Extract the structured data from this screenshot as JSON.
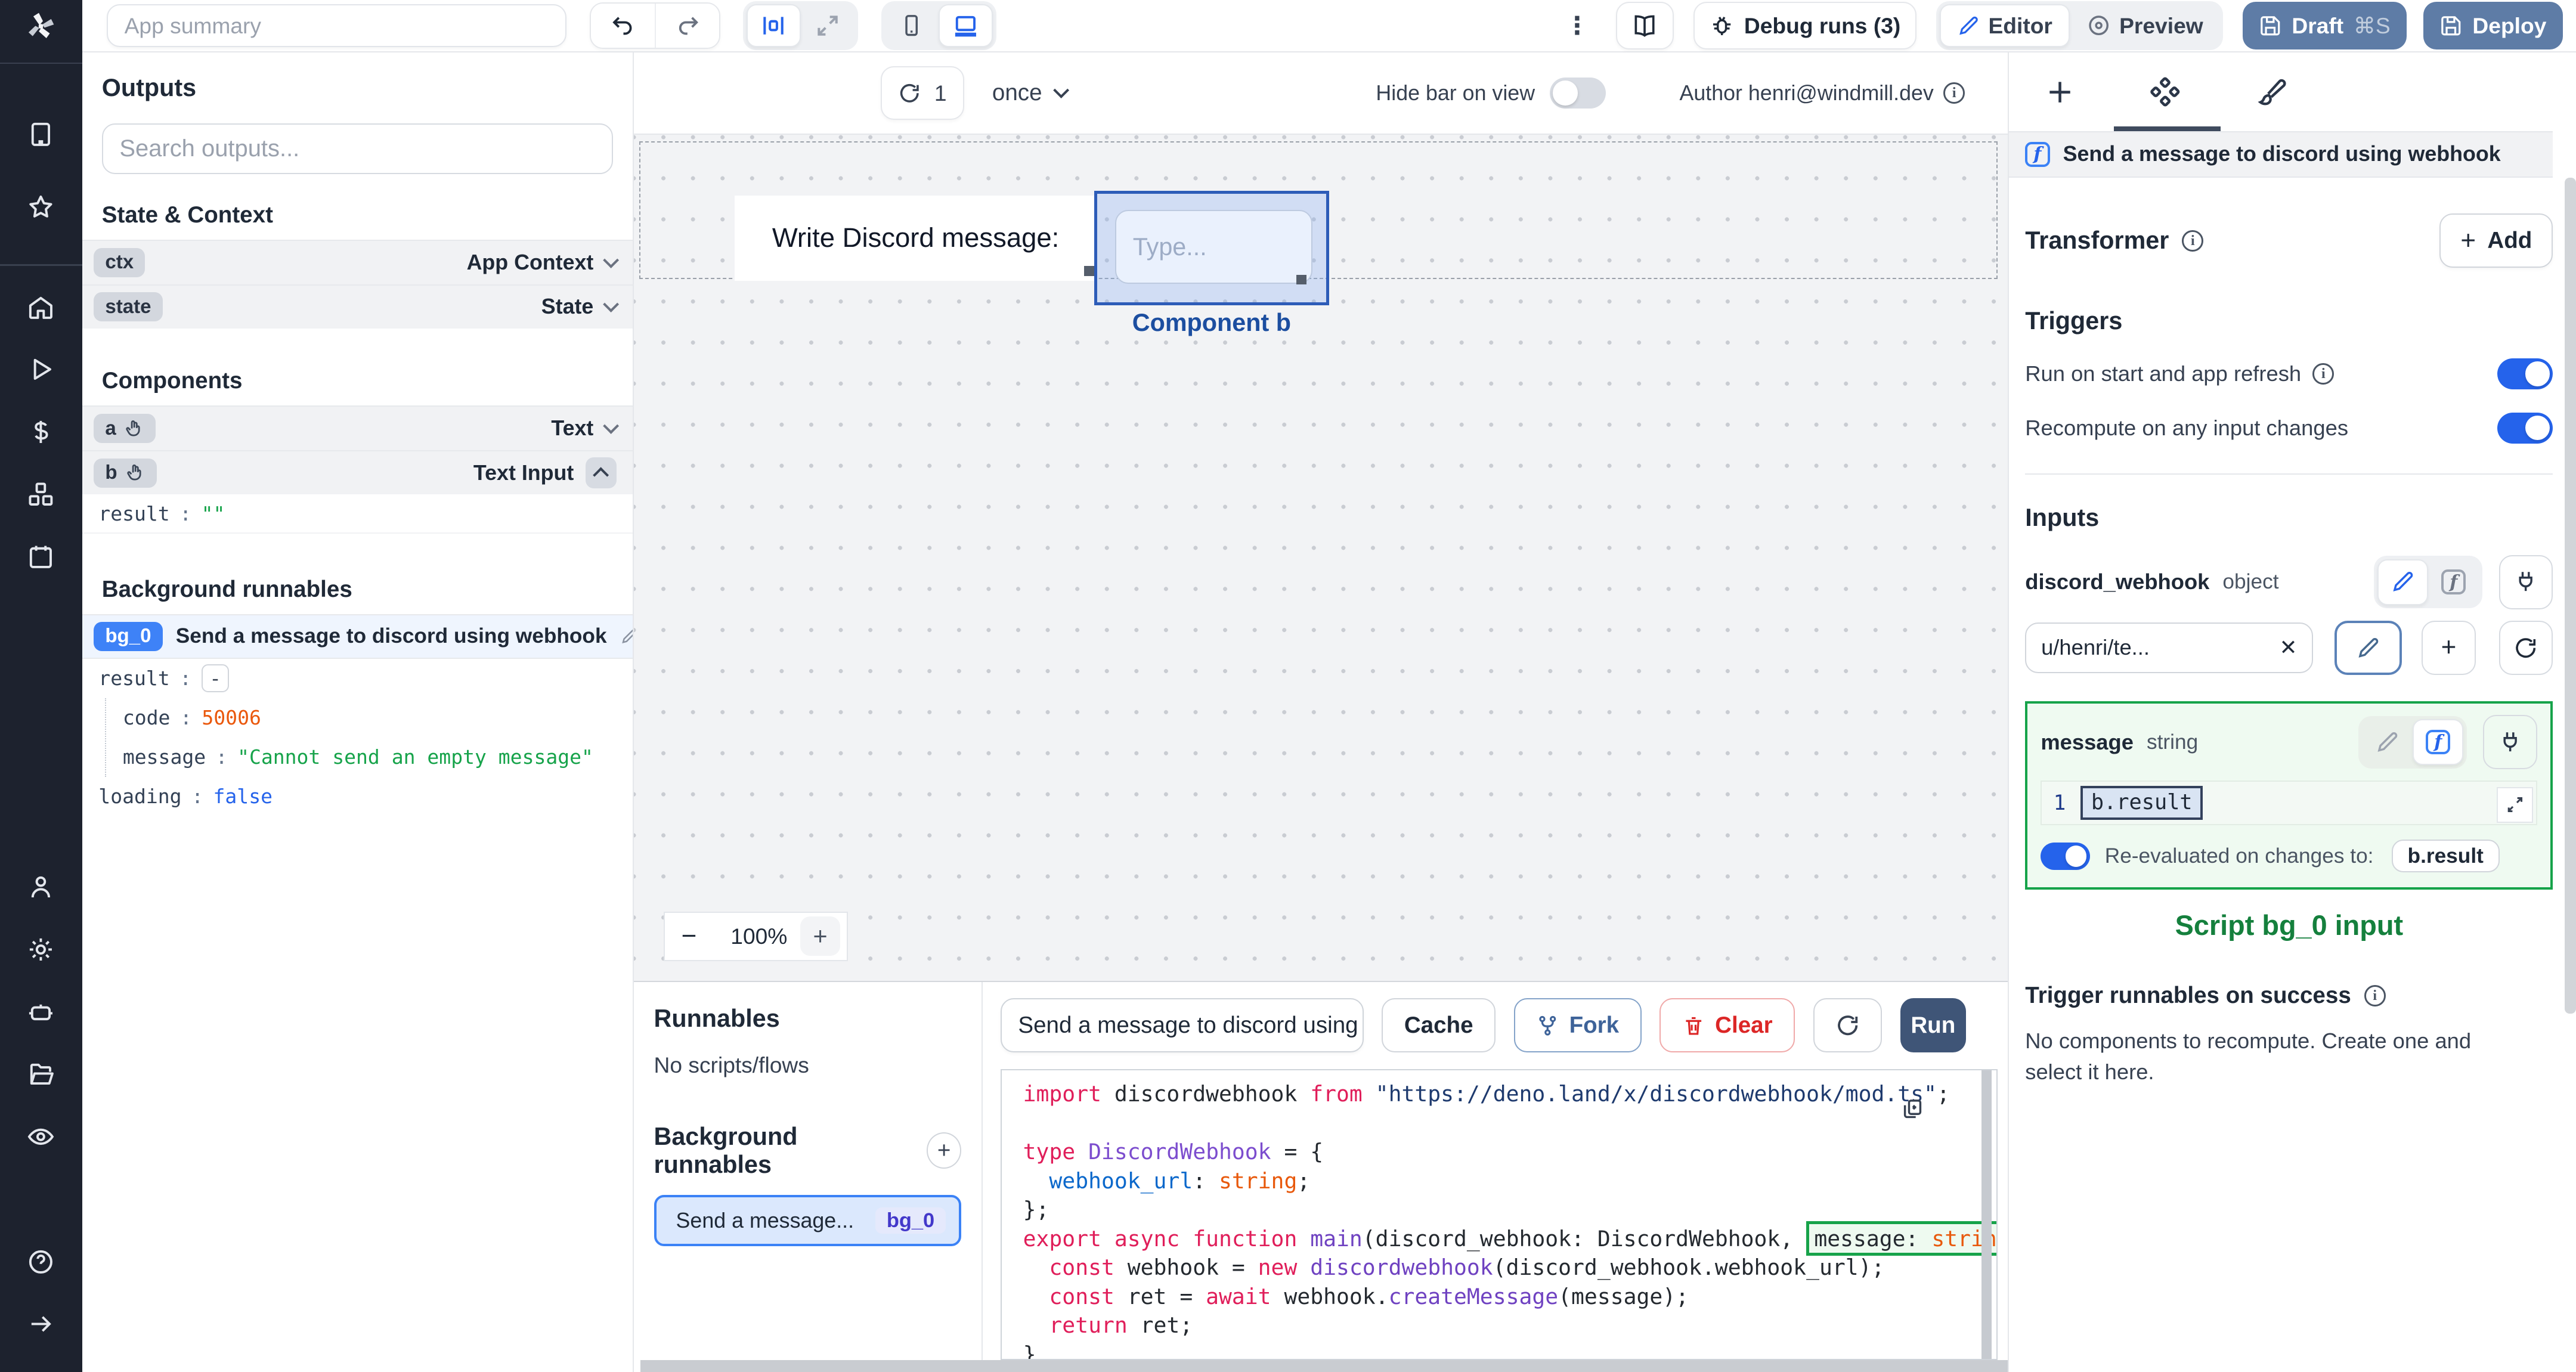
{
  "topbar": {
    "summary_placeholder": "App summary",
    "debug_runs_label": "Debug runs (3)",
    "editor_label": "Editor",
    "preview_label": "Preview",
    "draft_label": "Draft",
    "draft_shortcut": "⌘S",
    "deploy_label": "Deploy"
  },
  "canvas_toolbar": {
    "refresh_count": "1",
    "run_mode": "once",
    "hide_bar_label": "Hide bar on view",
    "author_label": "Author henri@windmill.dev"
  },
  "left_panel": {
    "outputs_title": "Outputs",
    "search_placeholder": "Search outputs...",
    "state_context_title": "State & Context",
    "context_rows": [
      {
        "id": "ctx",
        "type": "App Context"
      },
      {
        "id": "state",
        "type": "State"
      }
    ],
    "components_title": "Components",
    "component_rows": [
      {
        "id": "a",
        "type": "Text"
      },
      {
        "id": "b",
        "type": "Text Input"
      }
    ],
    "b_output": {
      "key": "result",
      "value": "\"\""
    },
    "background_title": "Background runnables",
    "bg0": {
      "badge": "bg_0",
      "name": "Send a message to discord using webhook",
      "result_key": "result",
      "collapse": "-",
      "code_key": "code",
      "code_value": "50006",
      "message_key": "message",
      "message_value": "\"Cannot send an empty message\"",
      "loading_key": "loading",
      "loading_value": "false"
    }
  },
  "canvas": {
    "text_component": "Write Discord message:",
    "input_placeholder": "Type...",
    "selected_component_label": "Component b",
    "zoom_out": "−",
    "zoom_level": "100%",
    "zoom_in": "+"
  },
  "runnables_panel": {
    "title": "Runnables",
    "empty_label": "No scripts/flows",
    "background_title": "Background runnables",
    "item_label": "Send a message...",
    "item_badge": "bg_0"
  },
  "editor_panel": {
    "script_name": "Send a message to discord using",
    "cache_label": "Cache",
    "fork_label": "Fork",
    "clear_label": "Clear",
    "run_label": "Run",
    "code": [
      [
        [
          "kw",
          "import"
        ],
        [
          "pl",
          " discordwebhook "
        ],
        [
          "kw",
          "from"
        ],
        [
          "str",
          " \"https://deno.land/x/discordwebhook/mod.ts\""
        ],
        [
          "pl",
          ";"
        ]
      ],
      [],
      [
        [
          "kw",
          "type"
        ],
        [
          "ty",
          " DiscordWebhook"
        ],
        [
          "pl",
          " = {"
        ]
      ],
      [
        [
          "pl",
          "  "
        ],
        [
          "pr",
          "webhook_url"
        ],
        [
          "pl",
          ": "
        ],
        [
          "or",
          "string"
        ],
        [
          "pl",
          ";"
        ]
      ],
      [
        [
          "pl",
          "};"
        ]
      ],
      [
        [
          "kw",
          "export"
        ],
        [
          "pl",
          " "
        ],
        [
          "kw",
          "async"
        ],
        [
          "pl",
          " "
        ],
        [
          "kw",
          "function"
        ],
        [
          "fn",
          " main"
        ],
        [
          "pl",
          "(discord_webhook: DiscordWebhook, "
        ],
        [
          "hlpl",
          "message: "
        ],
        [
          "hlor",
          "strin"
        ]
      ],
      [
        [
          "pl",
          "  "
        ],
        [
          "kw",
          "const"
        ],
        [
          "pl",
          " webhook = "
        ],
        [
          "kw",
          "new"
        ],
        [
          "fn",
          " discordwebhook"
        ],
        [
          "pl",
          "(discord_webhook.webhook_url);"
        ]
      ],
      [
        [
          "pl",
          "  "
        ],
        [
          "kw",
          "const"
        ],
        [
          "pl",
          " ret = "
        ],
        [
          "kw",
          "await"
        ],
        [
          "pl",
          " webhook."
        ],
        [
          "fn",
          "createMessage"
        ],
        [
          "pl",
          "(message);"
        ]
      ],
      [
        [
          "pl",
          "  "
        ],
        [
          "kw",
          "return"
        ],
        [
          "pl",
          " ret;"
        ]
      ],
      [
        [
          "pl",
          "}"
        ]
      ]
    ]
  },
  "right_panel": {
    "header_title": "Send a message to discord using webhook",
    "transformer_label": "Transformer",
    "add_label": "Add",
    "triggers_title": "Triggers",
    "trigger_run_on_start": "Run on start and app refresh",
    "trigger_recompute": "Recompute on any input changes",
    "inputs_title": "Inputs",
    "discord_webhook": {
      "name": "discord_webhook",
      "type": "object",
      "value": "u/henri/te..."
    },
    "message_input": {
      "name": "message",
      "type": "string",
      "line_number": "1",
      "expression": "b.result",
      "reeval_label": "Re-evaluated on changes to:",
      "reeval_target": "b.result"
    },
    "script_input_caption": "Script bg_0 input",
    "trigger_success_title": "Trigger runnables on success",
    "trigger_success_body": "No components to recompute. Create one and select it here."
  },
  "icons": {
    "rail": [
      "windmill-logo",
      "building",
      "star",
      "home",
      "play",
      "dollar",
      "cubes",
      "calendar",
      "user",
      "gear",
      "robot",
      "folder",
      "eye",
      "help-circle",
      "arrow-right"
    ],
    "accent_blue": "#2563eb",
    "toggle_on": "#2563eb",
    "highlight_green": "#16a34a",
    "caption_green": "#15803d",
    "draft_deploy_button": "#5e7ca6",
    "run_button": "#3f5577",
    "selection_blue": "#2d5cb8",
    "error_red": "#dc2626"
  }
}
